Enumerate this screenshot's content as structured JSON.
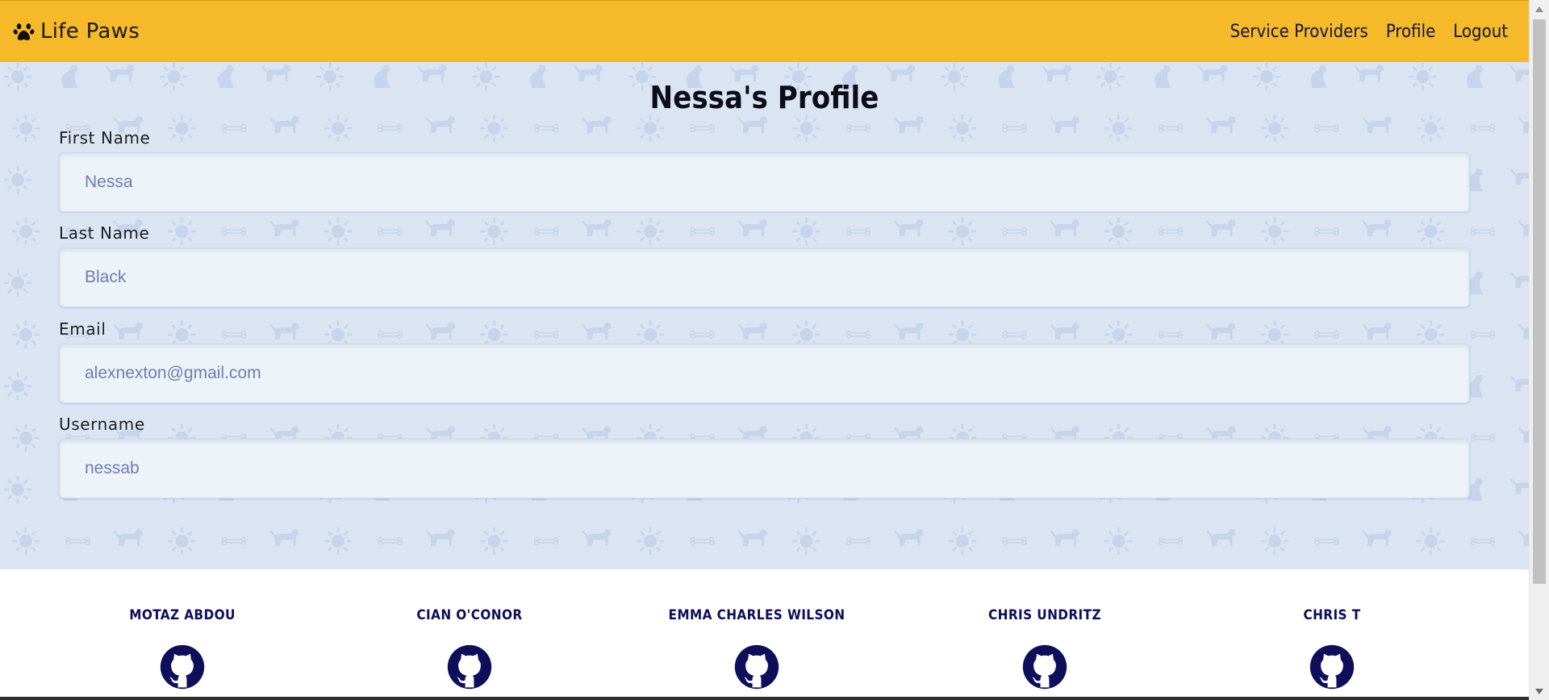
{
  "navbar": {
    "brand_icon": "paw-icon",
    "brand": "Life Paws",
    "links": [
      "Service Providers",
      "Profile",
      "Logout"
    ]
  },
  "profile": {
    "title": "Nessa's Profile",
    "fields": [
      {
        "label": "First Name",
        "value": "Nessa"
      },
      {
        "label": "Last Name",
        "value": "Black"
      },
      {
        "label": "Email",
        "value": "alexnexton@gmail.com"
      },
      {
        "label": "Username",
        "value": "nessab"
      }
    ]
  },
  "footer": {
    "members": [
      {
        "name": "MOTAZ ABDOU",
        "icon": "github-icon"
      },
      {
        "name": "CIAN O'CONOR",
        "icon": "github-icon"
      },
      {
        "name": "EMMA CHARLES WILSON",
        "icon": "github-icon"
      },
      {
        "name": "CHRIS UNDRITZ",
        "icon": "github-icon"
      },
      {
        "name": "CHRIS T",
        "icon": "github-icon"
      }
    ]
  },
  "colors": {
    "navbar": "#f5b92a",
    "background": "#dbe4f2",
    "pattern": "#c5d3ec",
    "input_background": "#eef3fa",
    "footer_text": "#0e0e5a",
    "github_icon": "#0e0e5a"
  }
}
